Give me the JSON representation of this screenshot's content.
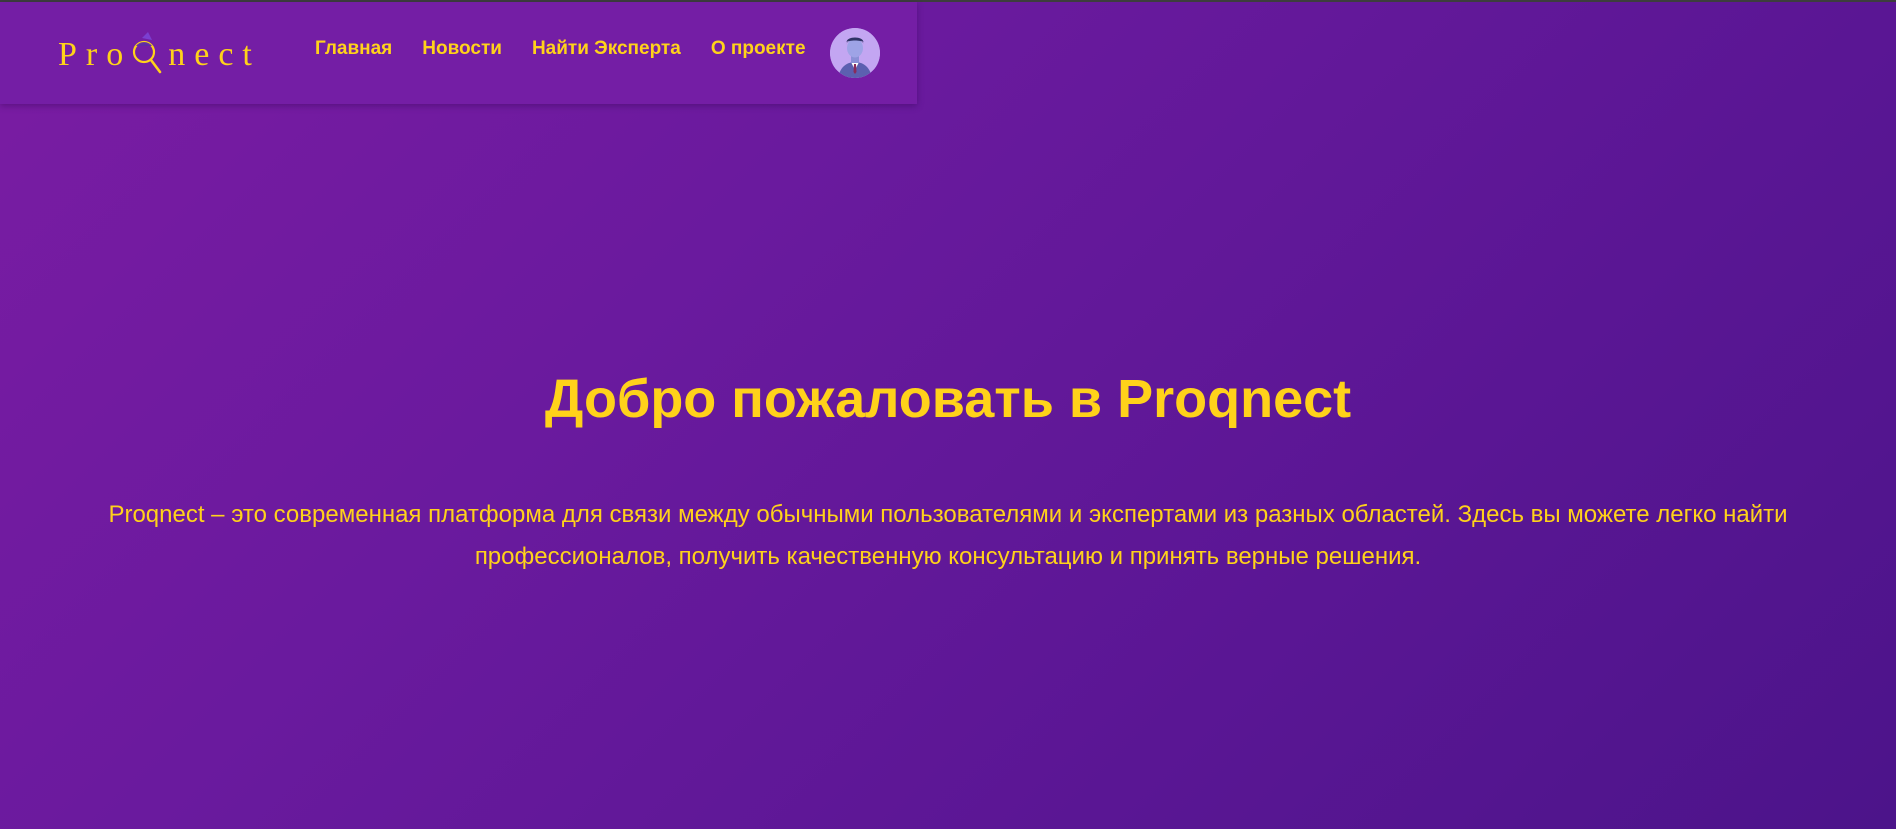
{
  "brand": {
    "logo_prefix": "Pro",
    "logo_suffix": "nect",
    "logo_icon": "magnifier-icon"
  },
  "nav": {
    "items": [
      {
        "label": "Главная"
      },
      {
        "label": "Новости"
      },
      {
        "label": "Найти Эксперта"
      },
      {
        "label": "О проекте"
      }
    ]
  },
  "avatar": {
    "icon": "user-avatar-icon"
  },
  "hero": {
    "title": "Добро пожаловать в Proqnect",
    "description": "Proqnect – это современная платформа для связи между обычными пользователями и экспертами из разных областей. Здесь вы можете легко найти профессионалов, получить качественную консультацию и принять верные решения."
  },
  "colors": {
    "accent": "#ffd21a",
    "background_start": "#7a1ca3",
    "background_end": "#4c148a",
    "navbar": "#741ea5"
  }
}
